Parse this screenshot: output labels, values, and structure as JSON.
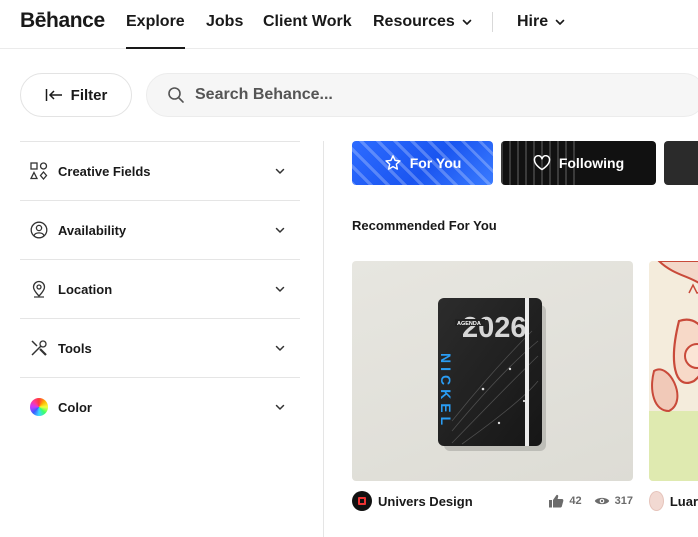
{
  "nav": {
    "logo": "Bēhance",
    "items": [
      {
        "label": "Explore",
        "active": true
      },
      {
        "label": "Jobs"
      },
      {
        "label": "Client Work"
      },
      {
        "label": "Resources",
        "dropdown": true
      },
      {
        "label": "Hire",
        "dropdown": true
      }
    ]
  },
  "filter": {
    "label": "Filter"
  },
  "search": {
    "placeholder": "Search Behance..."
  },
  "sidebar": {
    "items": [
      {
        "label": "Creative Fields",
        "icon": "shapes-icon"
      },
      {
        "label": "Availability",
        "icon": "person-circle-icon"
      },
      {
        "label": "Location",
        "icon": "map-pin-icon"
      },
      {
        "label": "Tools",
        "icon": "tools-icon"
      },
      {
        "label": "Color",
        "icon": "color-wheel-icon"
      }
    ]
  },
  "chips": {
    "for_you": "For You",
    "following": "Following"
  },
  "section": {
    "title": "Recommended For You"
  },
  "cards": [
    {
      "owner": "Univers Design",
      "likes": "42",
      "views": "317",
      "cover_text_year": "2026",
      "cover_text_name": "NICKEL",
      "cover_text_badge": "AGENDA"
    },
    {
      "owner": "Luar"
    }
  ],
  "colors": {
    "accent_blue": "#1a55f0",
    "text": "#191919",
    "muted": "#6b6b6b",
    "divider": "#e5e5e5"
  }
}
